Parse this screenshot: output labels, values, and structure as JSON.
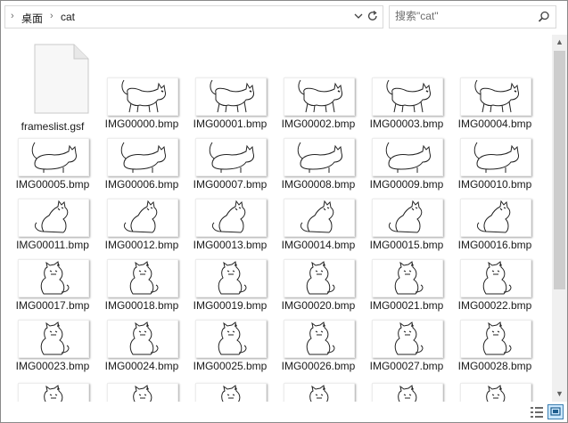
{
  "address": {
    "breadcrumbs": [
      "桌面",
      "cat"
    ],
    "icons": [
      "chevron-right-icon",
      "chevron-down-icon",
      "refresh-icon"
    ]
  },
  "search": {
    "placeholder": "搜索\"cat\"",
    "icon": "search-icon"
  },
  "files": [
    {
      "name": "frameslist.gsf",
      "type": "document"
    },
    {
      "name": "IMG00000.bmp",
      "type": "image"
    },
    {
      "name": "IMG00001.bmp",
      "type": "image"
    },
    {
      "name": "IMG00002.bmp",
      "type": "image"
    },
    {
      "name": "IMG00003.bmp",
      "type": "image"
    },
    {
      "name": "IMG00004.bmp",
      "type": "image"
    },
    {
      "name": "IMG00005.bmp",
      "type": "image"
    },
    {
      "name": "IMG00006.bmp",
      "type": "image"
    },
    {
      "name": "IMG00007.bmp",
      "type": "image"
    },
    {
      "name": "IMG00008.bmp",
      "type": "image"
    },
    {
      "name": "IMG00009.bmp",
      "type": "image"
    },
    {
      "name": "IMG00010.bmp",
      "type": "image"
    },
    {
      "name": "IMG00011.bmp",
      "type": "image"
    },
    {
      "name": "IMG00012.bmp",
      "type": "image"
    },
    {
      "name": "IMG00013.bmp",
      "type": "image"
    },
    {
      "name": "IMG00014.bmp",
      "type": "image"
    },
    {
      "name": "IMG00015.bmp",
      "type": "image"
    },
    {
      "name": "IMG00016.bmp",
      "type": "image"
    },
    {
      "name": "IMG00017.bmp",
      "type": "image"
    },
    {
      "name": "IMG00018.bmp",
      "type": "image"
    },
    {
      "name": "IMG00019.bmp",
      "type": "image"
    },
    {
      "name": "IMG00020.bmp",
      "type": "image"
    },
    {
      "name": "IMG00021.bmp",
      "type": "image"
    },
    {
      "name": "IMG00022.bmp",
      "type": "image"
    },
    {
      "name": "IMG00023.bmp",
      "type": "image"
    },
    {
      "name": "IMG00024.bmp",
      "type": "image"
    },
    {
      "name": "IMG00025.bmp",
      "type": "image"
    },
    {
      "name": "IMG00026.bmp",
      "type": "image"
    },
    {
      "name": "IMG00027.bmp",
      "type": "image"
    },
    {
      "name": "IMG00028.bmp",
      "type": "image"
    },
    {
      "name": "",
      "type": "image"
    },
    {
      "name": "",
      "type": "image"
    },
    {
      "name": "",
      "type": "image"
    },
    {
      "name": "",
      "type": "image"
    },
    {
      "name": "",
      "type": "image"
    },
    {
      "name": "",
      "type": "image"
    }
  ],
  "view_buttons": [
    "details-view-icon",
    "large-icons-view-icon"
  ],
  "colors": {
    "selected_view": "#cce8ff",
    "selected_border": "#3c7fb1",
    "scroll_thumb": "#cdcdcd"
  }
}
